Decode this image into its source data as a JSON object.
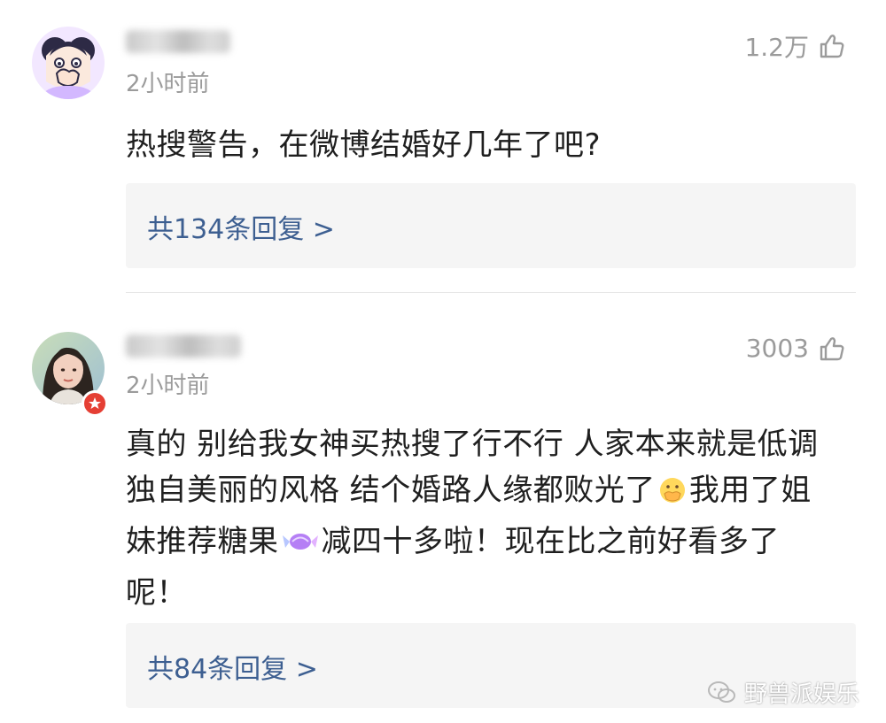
{
  "comments": [
    {
      "avatar_icon": "cartoon-girl-avatar",
      "username": "",
      "time": "2小时前",
      "likes": "1.2万",
      "text": "热搜警告，在微博结婚好几年了吧?",
      "replies": "共134条回复 >"
    },
    {
      "avatar_icon": "woman-photo-avatar",
      "verified": true,
      "username": "",
      "time": "2小时前",
      "likes": "3003",
      "text_parts": [
        "真的 别给我女神买热搜了行不行 人家本来就是低调独自美丽的风格 结个婚路人缘都败光了",
        "我用了姐妹推荐糖果",
        "减四十多啦！现在比之前好看多了呢！"
      ],
      "replies": "共84条回复 >"
    }
  ],
  "watermark": "野兽派娱乐",
  "colors": {
    "reply_text": "#3d5f91",
    "reply_bg": "#f5f5f5",
    "meta_text": "#9b9b9b",
    "body_text": "#1f1f1f",
    "verified_badge": "#e53f34"
  },
  "icons": {
    "like": "thumbs-up-icon",
    "emoji": "cover-mouth-emoji-icon",
    "candy": "candy-emoji-icon",
    "watermark": "wechat-icon"
  }
}
